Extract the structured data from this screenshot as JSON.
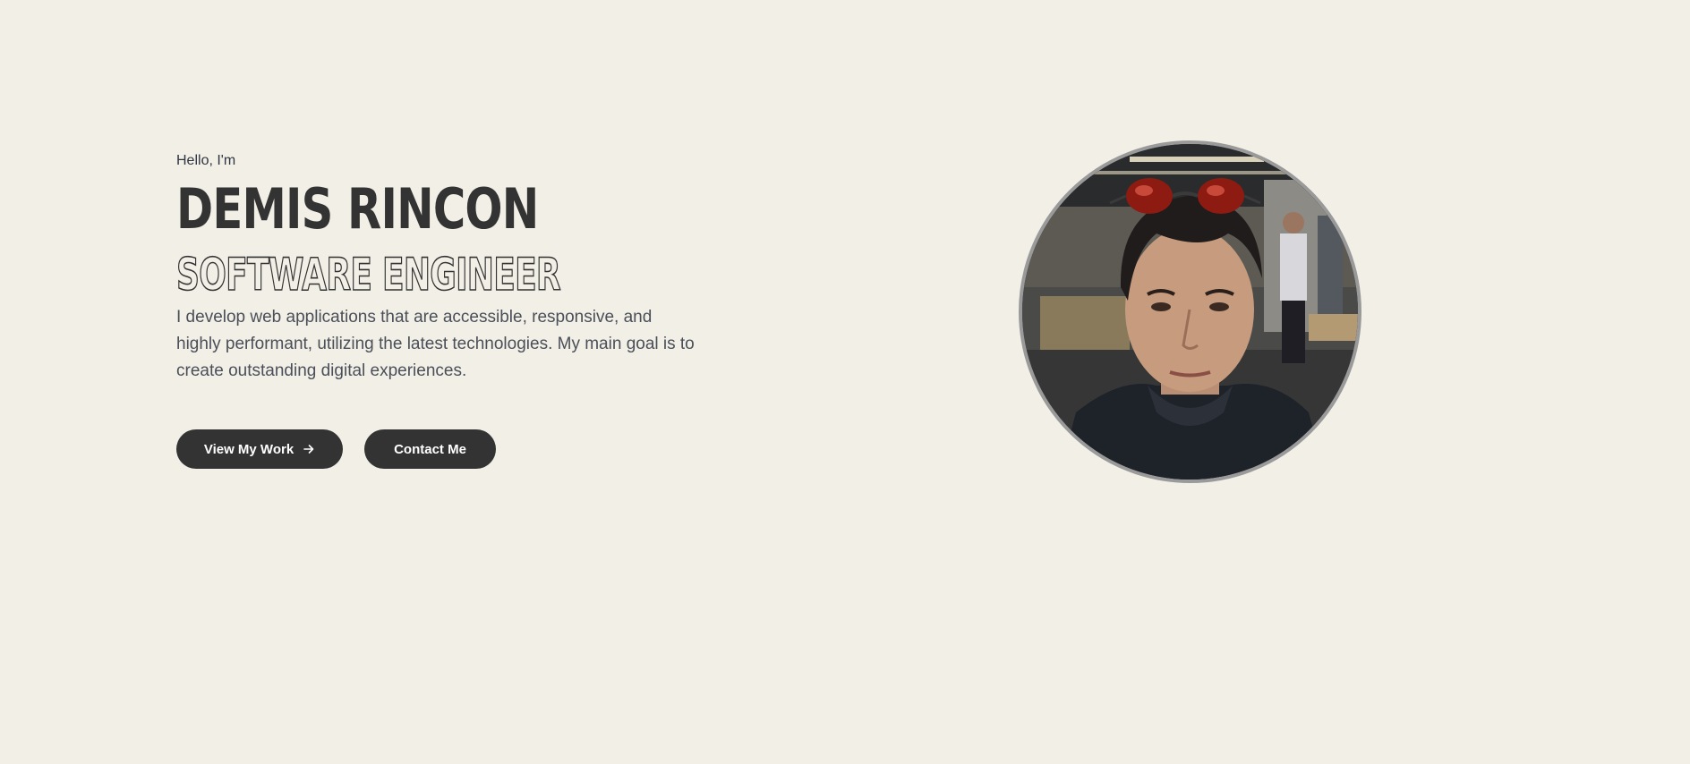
{
  "hero": {
    "greeting": "Hello, I'm",
    "name": "DEMIS RINCON",
    "role": "SOFTWARE ENGINEER",
    "bio": "I develop web applications that are accessible, responsive, and highly performant, utilizing the latest technologies. My main goal is to create outstanding digital experiences."
  },
  "actions": {
    "view_work_label": "View My Work",
    "view_work_icon": "arrow-right-icon",
    "contact_label": "Contact Me"
  },
  "colors": {
    "background": "#f2efe7",
    "button": "#333333",
    "button_text": "#ffffff",
    "heading": "#333333",
    "avatar_border": "#9a9a9a"
  }
}
